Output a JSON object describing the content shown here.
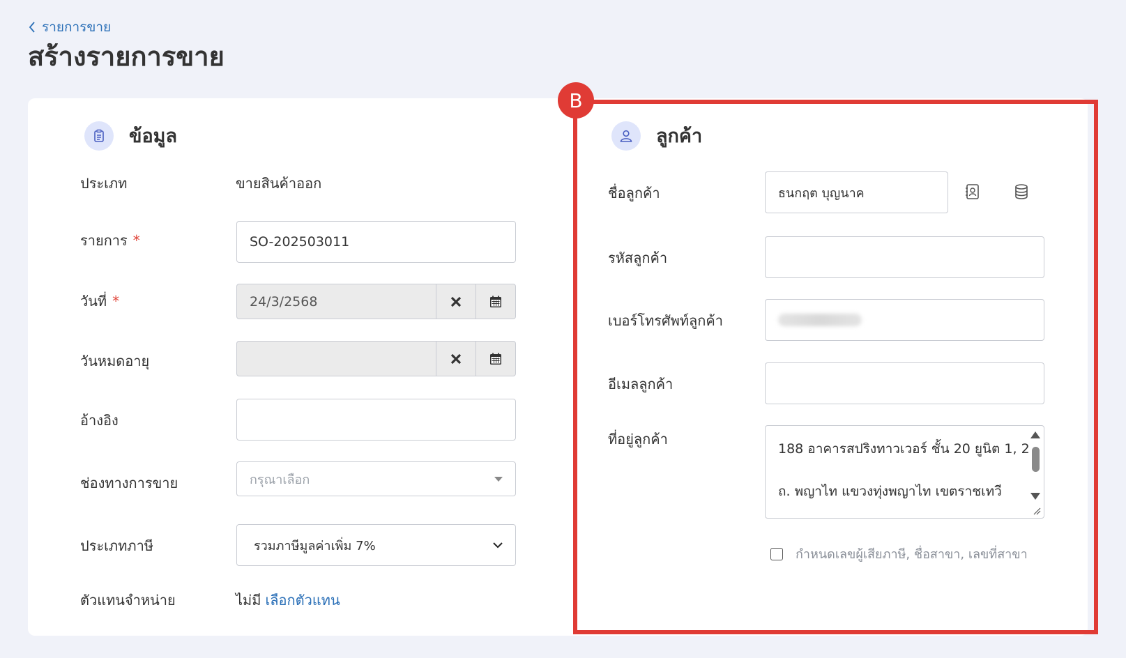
{
  "header": {
    "back_label": "รายการขาย",
    "title": "สร้างรายการขาย"
  },
  "info_section": {
    "title": "ข้อมูล",
    "type_label": "ประเภท",
    "type_value": "ขายสินค้าออก",
    "doc_label": "รายการ",
    "doc_value": "SO-202503011",
    "date_label": "วันที่",
    "date_value": "24/3/2568",
    "expiry_label": "วันหมดอายุ",
    "expiry_value": "",
    "reference_label": "อ้างอิง",
    "reference_value": "",
    "channel_label": "ช่องทางการขาย",
    "channel_placeholder": "กรุณาเลือก",
    "tax_label": "ประเภทภาษี",
    "tax_value": "รวมภาษีมูลค่าเพิ่ม 7%",
    "agent_label": "ตัวแทนจำหน่าย",
    "agent_value": "ไม่มี",
    "agent_link": "เลือกตัวแทน"
  },
  "customer_section": {
    "badge": "B",
    "title": "ลูกค้า",
    "name_label": "ชื่อลูกค้า",
    "name_value": "ธนกฤต บุญนาค",
    "code_label": "รหัสลูกค้า",
    "code_value": "",
    "phone_label": "เบอร์โทรศัพท์ลูกค้า",
    "email_label": "อีเมลลูกค้า",
    "email_value": "",
    "address_label": "ที่อยู่ลูกค้า",
    "address_line1": "188 อาคารสปริงทาวเวอร์ ชั้น 20 ยูนิต 1, 2",
    "address_line2": "ถ. พญาไท แขวงทุ่งพญาไท เขตราชเทวี",
    "tax_checkbox_label": "กำหนดเลขผู้เสียภาษี, ชื่อสาขา, เลขที่สาขา",
    "tax_checkbox_checked": false
  },
  "colors": {
    "accent": "#2a6fb7",
    "highlight": "#e03b35",
    "background": "#f0f2f9"
  }
}
